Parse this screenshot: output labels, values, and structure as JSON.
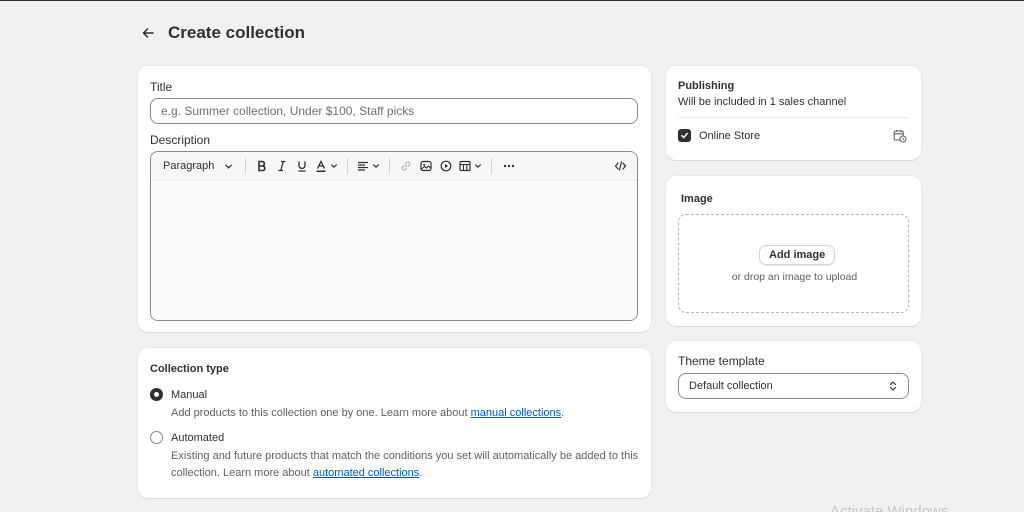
{
  "page": {
    "title": "Create collection"
  },
  "details": {
    "title_label": "Title",
    "title_placeholder": "e.g. Summer collection, Under $100, Staff picks",
    "title_value": "",
    "description_label": "Description",
    "toolbar": {
      "paragraph_label": "Paragraph",
      "icons": [
        "bold-icon",
        "italic-icon",
        "underline-icon",
        "text-color-icon",
        "align-icon",
        "link-icon",
        "image-icon",
        "video-icon",
        "table-icon",
        "more-icon",
        "code-icon"
      ]
    }
  },
  "collection_type": {
    "heading": "Collection type",
    "options": [
      {
        "label": "Manual",
        "checked": true,
        "help_prefix": "Add products to this collection one by one. Learn more about ",
        "help_link": "manual collections",
        "help_suffix": "."
      },
      {
        "label": "Automated",
        "checked": false,
        "help_prefix": "Existing and future products that match the conditions you set will automatically be added to this collection. Learn more about ",
        "help_link": "automated collections",
        "help_suffix": "."
      }
    ]
  },
  "publishing": {
    "heading": "Publishing",
    "subtext": "Will be included in 1 sales channel",
    "channels": [
      {
        "label": "Online Store",
        "checked": true
      }
    ]
  },
  "image": {
    "heading": "Image",
    "add_button": "Add image",
    "drop_hint": "or drop an image to upload"
  },
  "theme_template": {
    "label": "Theme template",
    "selected": "Default collection"
  },
  "watermark": "Activate Windows",
  "colors": {
    "accent_link": "#005bd3",
    "text": "#303030",
    "background": "#f1f1f1"
  }
}
